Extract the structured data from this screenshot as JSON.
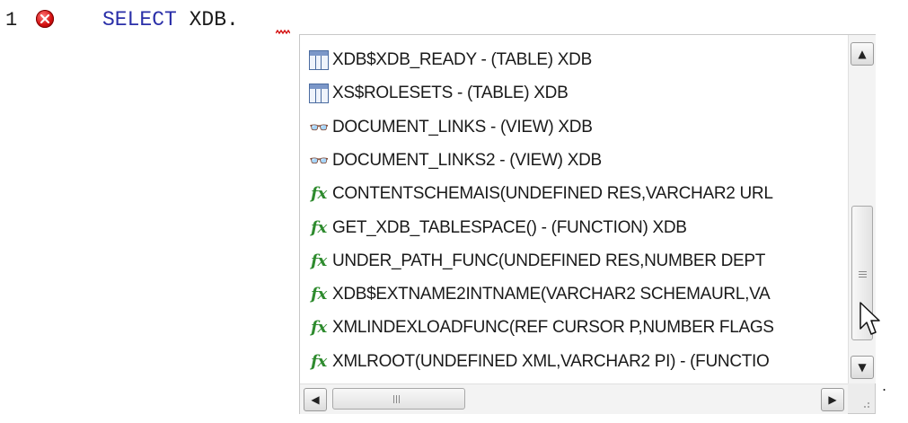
{
  "editor": {
    "line_number": "1",
    "keyword": "SELECT",
    "typed_text": " XDB."
  },
  "autocomplete": {
    "items": [
      {
        "icon": "table-icon",
        "label": "XDB$XDB_READY - (TABLE) XDB"
      },
      {
        "icon": "table-icon",
        "label": "XS$ROLESETS - (TABLE) XDB"
      },
      {
        "icon": "view-icon",
        "label": "DOCUMENT_LINKS - (VIEW) XDB"
      },
      {
        "icon": "view-icon",
        "label": "DOCUMENT_LINKS2 - (VIEW) XDB"
      },
      {
        "icon": "function-icon",
        "label": "CONTENTSCHEMAIS(UNDEFINED RES,VARCHAR2 URL"
      },
      {
        "icon": "function-icon",
        "label": "GET_XDB_TABLESPACE() - (FUNCTION) XDB"
      },
      {
        "icon": "function-icon",
        "label": "UNDER_PATH_FUNC(UNDEFINED RES,NUMBER DEPT"
      },
      {
        "icon": "function-icon",
        "label": "XDB$EXTNAME2INTNAME(VARCHAR2 SCHEMAURL,VA"
      },
      {
        "icon": "function-icon",
        "label": "XMLINDEXLOADFUNC(REF CURSOR P,NUMBER FLAGS"
      },
      {
        "icon": "function-icon",
        "label": "XMLROOT(UNDEFINED XML,VARCHAR2 PI) - (FUNCTIO"
      }
    ],
    "fx_glyph": "fx",
    "view_glyph": "👓",
    "scroll_up": "▲",
    "scroll_down": "▼",
    "scroll_left": "◀",
    "scroll_right": "▶"
  },
  "trailing_text": "."
}
